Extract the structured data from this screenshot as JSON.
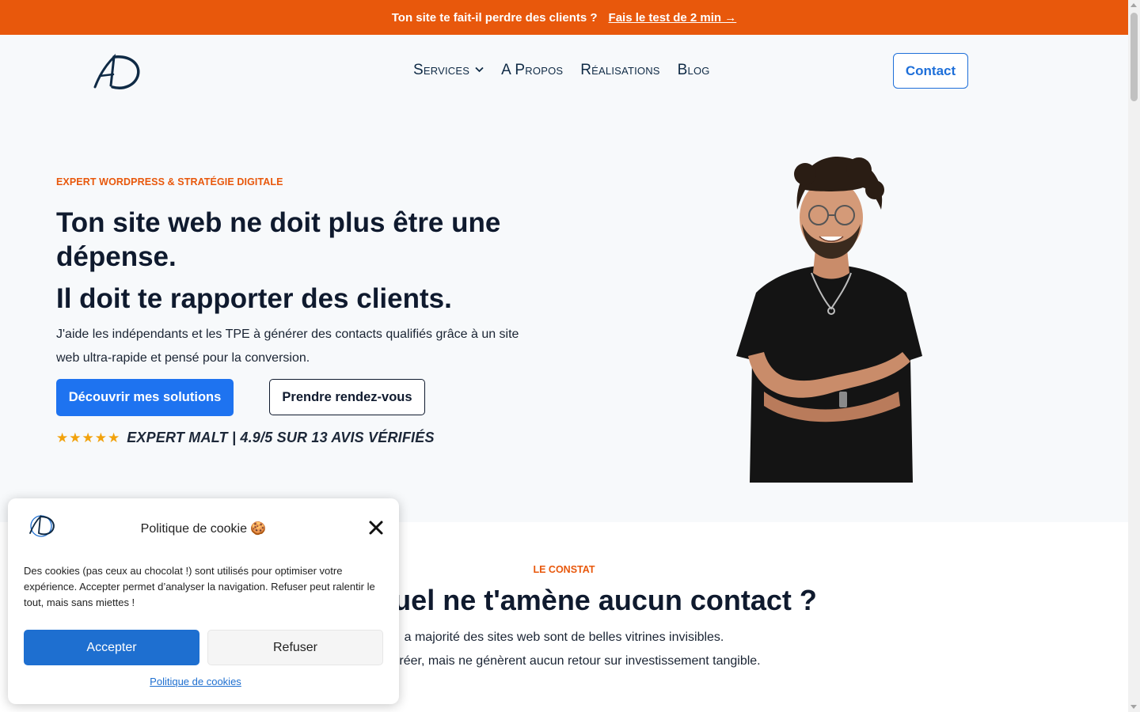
{
  "banner": {
    "text": "Ton site te fait-il perdre des clients ?",
    "link_label": "Fais le test de 2 min →"
  },
  "header": {
    "logo_text": "AD",
    "nav": [
      {
        "label": "Services",
        "has_dropdown": true
      },
      {
        "label": "A Propos"
      },
      {
        "label": "Réalisations"
      },
      {
        "label": "Blog"
      }
    ],
    "contact_label": "Contact"
  },
  "hero": {
    "eyebrow": "EXPERT WORDPRESS & STRATÉGIE DIGITALE",
    "title_line1": "Ton site web ne doit plus être une dépense.",
    "title_line2": "Il doit te rapporter des clients.",
    "lead": "J'aide les indépendants et les TPE à générer des contacts qualifiés grâce à un site web ultra-rapide et pensé pour la conversion.",
    "primary_cta": "Découvrir mes solutions",
    "secondary_cta": "Prendre rendez-vous",
    "stars": "★★★★★",
    "rating_text": "EXPERT MALT | 4.9/5 SUR 13 AVIS VÉRIFIÉS"
  },
  "section2": {
    "eyebrow": "LE CONSTAT",
    "title": "ite actuel ne t'amène aucun contact ?",
    "para1": "a majorité des sites web sont de belles vitrines invisibles.",
    "para2": "er à créer, mais ne génèrent aucun retour sur investissement tangible."
  },
  "cookie": {
    "title": "Politique de cookie 🍪",
    "text": "Des cookies (pas ceux au chocolat !) sont utilisés pour optimiser votre expérience. Accepter permet d’analyser la navigation. Refuser peut ralentir le tout, mais sans miettes !",
    "accept_label": "Accepter",
    "refuse_label": "Refuser",
    "policy_link": "Politique de cookies"
  },
  "colors": {
    "accent_orange": "#e8580c",
    "primary_blue": "#1e73f0",
    "text_dark": "#0f1a2e",
    "star_gold": "#f2a20c"
  }
}
